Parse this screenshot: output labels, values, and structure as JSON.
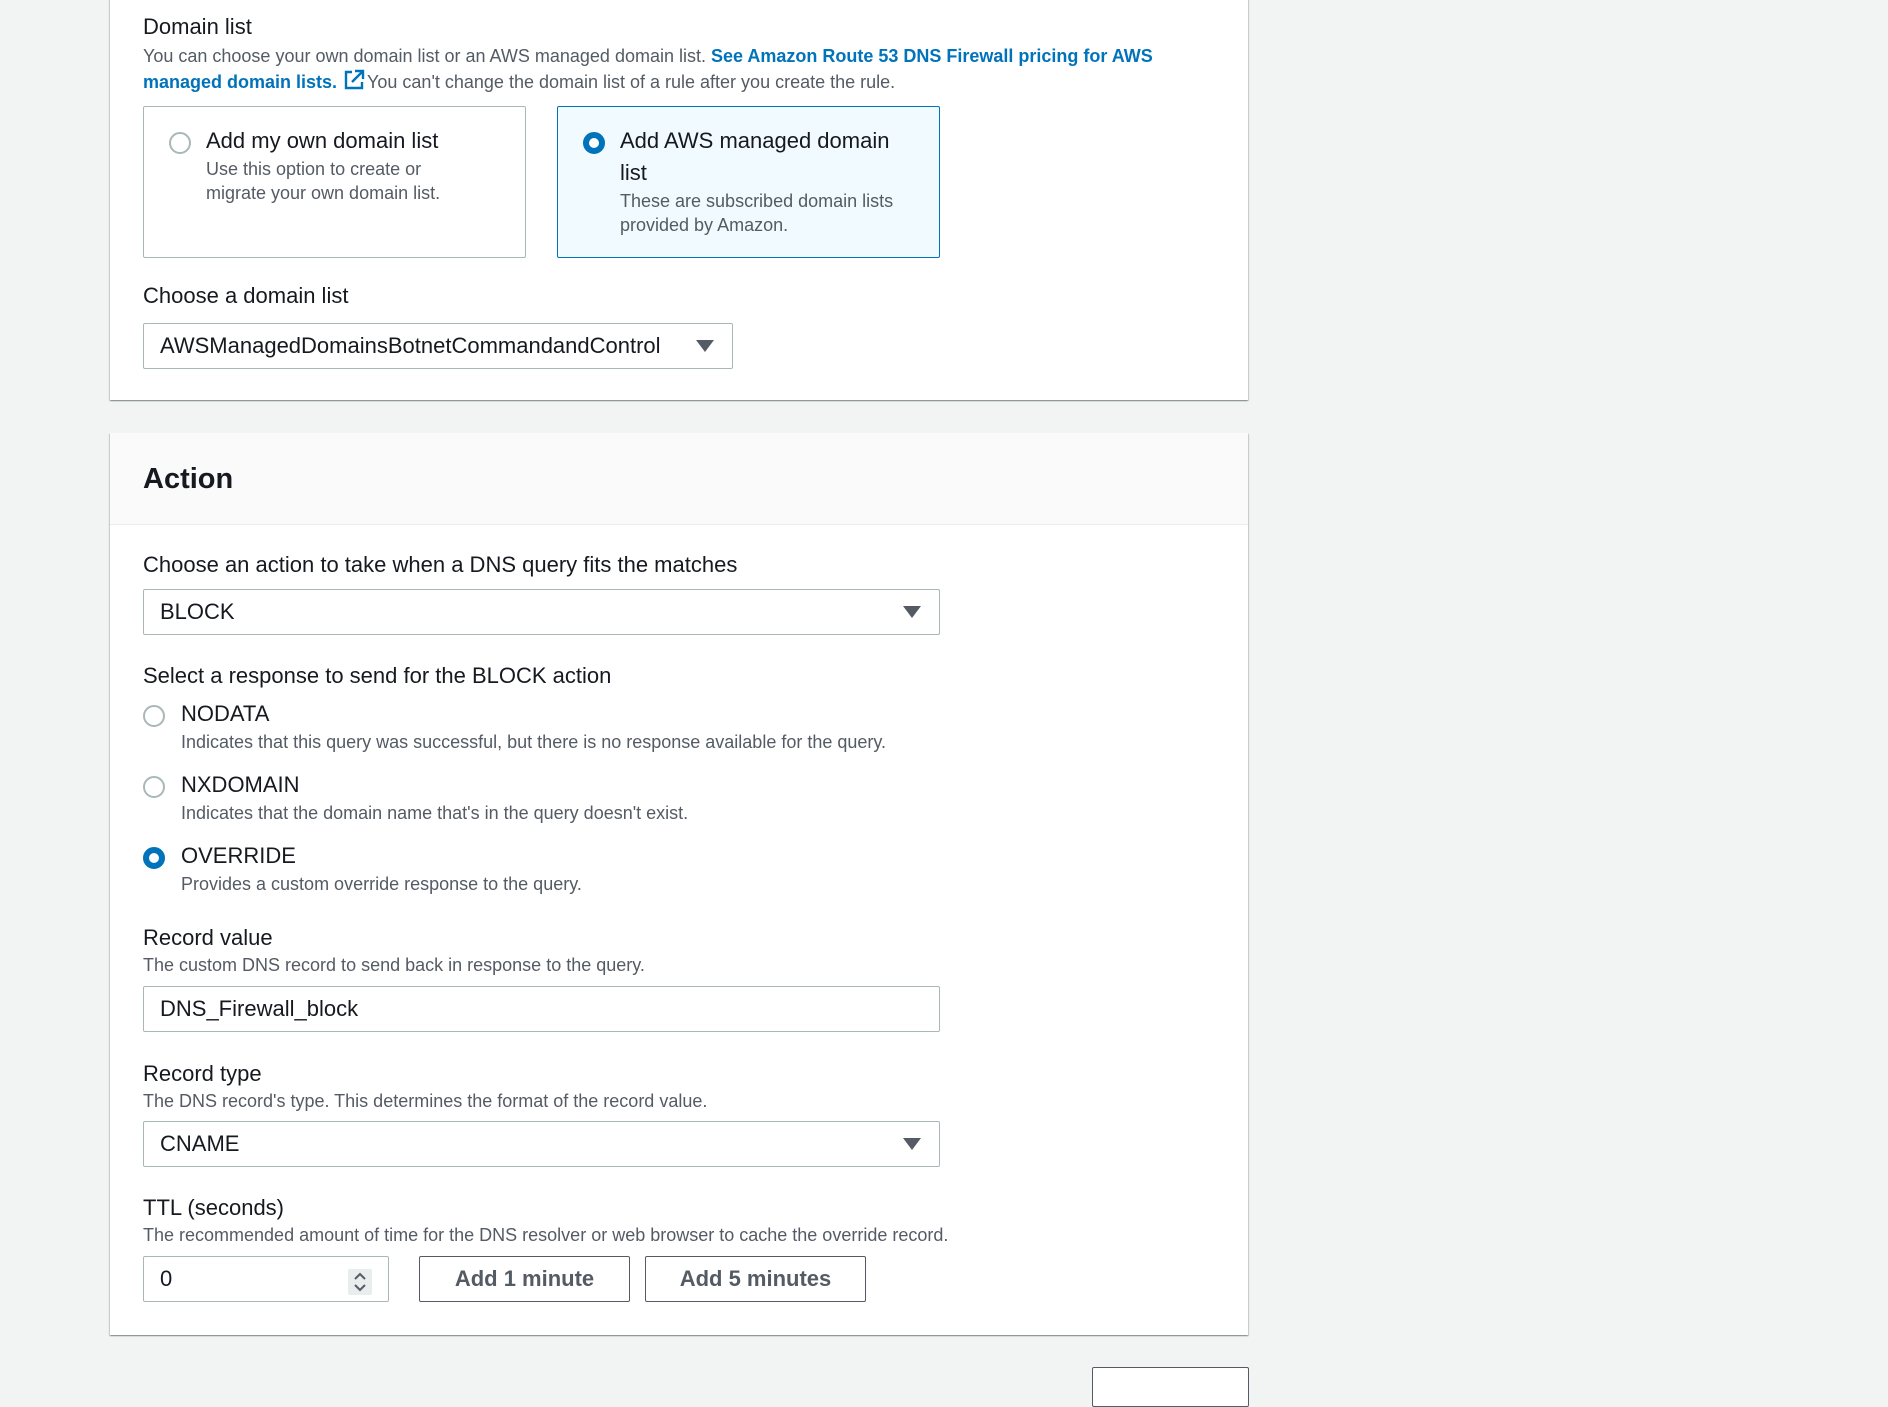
{
  "domain_list": {
    "label": "Domain list",
    "desc_prefix": "You can choose your own domain list or an AWS managed domain list.",
    "pricing_link_line1": "See Amazon Route 53 DNS Firewall pricing for AWS",
    "pricing_link_line2": "managed domain lists.",
    "desc_suffix": "You can't change the domain list of a rule after you create the rule.",
    "options": [
      {
        "title": "Add my own domain list",
        "desc_line1": "Use this option to create or",
        "desc_line2": "migrate your own domain list.",
        "selected": false
      },
      {
        "title_line1": "Add AWS managed domain",
        "title_line2": "list",
        "desc_line1": "These are subscribed domain lists",
        "desc_line2": "provided by Amazon.",
        "selected": true
      }
    ],
    "choose_label": "Choose a domain list",
    "choose_value": "AWSManagedDomainsBotnetCommandandControl"
  },
  "action": {
    "title": "Action",
    "choose_label": "Choose an action to take when a DNS query fits the matches",
    "choose_value": "BLOCK",
    "response_label": "Select a response to send for the BLOCK action",
    "responses": [
      {
        "title": "NODATA",
        "desc": "Indicates that this query was successful, but there is no response available for the query.",
        "selected": false
      },
      {
        "title": "NXDOMAIN",
        "desc": "Indicates that the domain name that's in the query doesn't exist.",
        "selected": false
      },
      {
        "title": "OVERRIDE",
        "desc": "Provides a custom override response to the query.",
        "selected": true
      }
    ],
    "record_value": {
      "label": "Record value",
      "desc": "The custom DNS record to send back in response to the query.",
      "value": "DNS_Firewall_block"
    },
    "record_type": {
      "label": "Record type",
      "desc": "The DNS record's type. This determines the format of the record value.",
      "value": "CNAME"
    },
    "ttl": {
      "label": "TTL (seconds)",
      "desc": "The recommended amount of time for the DNS resolver or web browser to cache the override record.",
      "value": "0",
      "add_1_label": "Add 1 minute",
      "add_5_label": "Add 5 minutes"
    }
  },
  "colors": {
    "accent": "#0073bb",
    "selected_tile_bg": "#f1faff",
    "text": "#16191f",
    "secondary_text": "#545b64",
    "border": "#aab7b8"
  },
  "icons": {
    "external_link": "external-link-icon",
    "dropdown": "caret-down-icon",
    "spinner": "number-spinner-icon"
  }
}
